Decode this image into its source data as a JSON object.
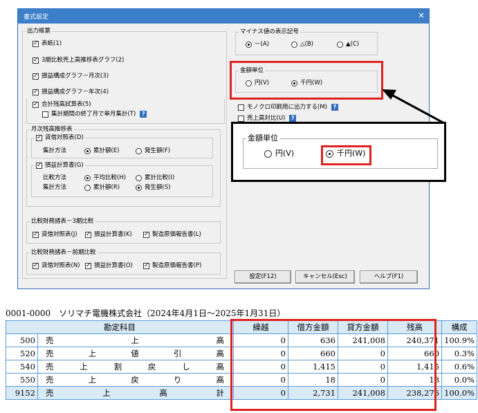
{
  "dialog": {
    "title": "書式設定",
    "close_glyph": "×",
    "output_group": {
      "label": "出力帳票",
      "items": [
        "表紙(1)",
        "3期比較売上高推移表グラフ(2)",
        "損益構成グラフ－月次(3)",
        "損益構成グラフ－年次(4)",
        "合計残高試算表(5)"
      ],
      "sub_item": "集計期間の終了月で単月集計(T)",
      "monthly_group": {
        "label": "月次残高推移表",
        "bs": {
          "label": "貸借対照表(D)",
          "method_label": "集計方法",
          "opt1": "累計額(E)",
          "opt2": "発生額(F)"
        },
        "pl": {
          "label": "損益計算書(G)",
          "compare_label": "比較方法",
          "cmp1": "平均比較(H)",
          "cmp2": "累計比較(I)",
          "method_label": "集計方法",
          "opt1": "累計額(R)",
          "opt2": "発生額(S)"
        }
      },
      "compare3": {
        "label": "比較財務諸表－3期比較",
        "items": [
          "貸借対照表(J)",
          "損益計算書(K)",
          "製造原価報告書(L)"
        ]
      },
      "comparePrev": {
        "label": "比較財務諸表－前期比較",
        "items": [
          "貸借対照表(N)",
          "損益計算書(O)",
          "製造原価報告書(P)"
        ]
      }
    },
    "minus": {
      "label": "マイナス値の表示記号",
      "opt1": "－(A)",
      "opt2": "△(B)",
      "opt3": "▲(C)"
    },
    "unit": {
      "label": "金額単位",
      "opt1": "円(V)",
      "opt2": "千円(W)"
    },
    "mono": "モノクロ印刷用に出力する(M)",
    "sales_ratio": "売上高対比(U)",
    "help_glyph": "?",
    "buttons": {
      "ok": "設定(F12)",
      "cancel": "キャンセル(Esc)",
      "help": "ヘルプ(F1)"
    }
  },
  "zoom": {
    "label": "金額単位",
    "opt1": "円(V)",
    "opt2": "千円(W)"
  },
  "report": {
    "company": "0001-0000　ソリマチ電機株式会社（2024年4月1日～2025年1月31日）",
    "headers": [
      "勘定科目",
      "繰越",
      "借方金額",
      "貸方金額",
      "残高",
      "構成"
    ],
    "rows": [
      {
        "code": "500",
        "chars": [
          "売",
          "上",
          "高"
        ],
        "carry": "0",
        "debit": "636",
        "credit": "241,008",
        "balance": "240,371",
        "ratio": "100.9%"
      },
      {
        "code": "520",
        "chars": [
          "売",
          "上",
          "値",
          "引",
          "高"
        ],
        "carry": "0",
        "debit": "660",
        "credit": "0",
        "balance": "660",
        "ratio": "0.3%"
      },
      {
        "code": "540",
        "chars": [
          "売",
          "上",
          "割",
          "戻",
          "し",
          "高"
        ],
        "carry": "0",
        "debit": "1,415",
        "credit": "0",
        "balance": "1,415",
        "ratio": "0.6%"
      },
      {
        "code": "550",
        "chars": [
          "売",
          "上",
          "戻",
          "り",
          "高"
        ],
        "carry": "0",
        "debit": "18",
        "credit": "0",
        "balance": "18",
        "ratio": "0.0%"
      },
      {
        "code": "9152",
        "chars": [
          "売",
          "上",
          "高",
          "計"
        ],
        "carry": "0",
        "debit": "2,731",
        "credit": "241,008",
        "balance": "238,276",
        "ratio": "100.0%"
      }
    ]
  },
  "colors": {
    "highlight": "#e02020",
    "header_bg": "#d9eaf7",
    "titlebar": "#3c7fc8"
  }
}
